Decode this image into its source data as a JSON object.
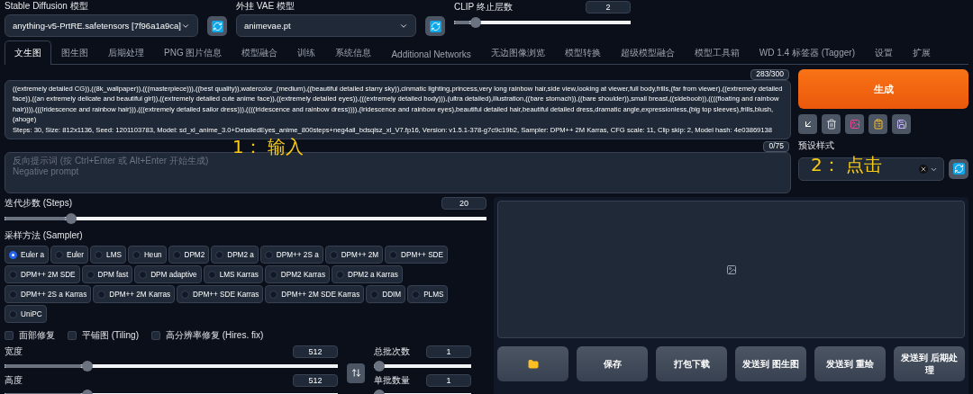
{
  "top_bar": {
    "model": {
      "label": "Stable Diffusion 模型",
      "value": "anything-v5-PrtRE.safetensors [7f96a1a9ca]"
    },
    "vae": {
      "label": "外挂 VAE 模型",
      "value": "animevae.pt"
    },
    "clip": {
      "label": "CLIP 终止层数",
      "value": "2",
      "level": 0.1
    }
  },
  "tabs": [
    {
      "label": "文生图",
      "selected": true
    },
    {
      "label": "图生图",
      "selected": false
    },
    {
      "label": "后期处理",
      "selected": false
    },
    {
      "label": "PNG 图片信息",
      "selected": false
    },
    {
      "label": "模型融合",
      "selected": false
    },
    {
      "label": "训练",
      "selected": false
    },
    {
      "label": "系统信息",
      "selected": false
    },
    {
      "label": "Additional Networks",
      "selected": false
    },
    {
      "label": "无边图像浏览",
      "selected": false
    },
    {
      "label": "模型转换",
      "selected": false
    },
    {
      "label": "超级模型融合",
      "selected": false
    },
    {
      "label": "模型工具箱",
      "selected": false
    },
    {
      "label": "WD 1.4 标签器 (Tagger)",
      "selected": false
    },
    {
      "label": "设置",
      "selected": false
    },
    {
      "label": "扩展",
      "selected": false
    }
  ],
  "prompt": {
    "counter": "283/300",
    "text": "((extremely detailed CG)),((8k_wallpaper)),(((masterpiece))),((best quality)),watercolor_(medium),((beautiful detailed starry sky)),cinmatic lighting,princess,very long rainbow hair,side view,looking at viewer,full body,frills,(far from viewer),((extremely detailed face)),((an extremely delicate and beautiful girl)),((extremely detailed cute anime face)),((extremely detailed eyes)),(((extremely detailed body))),(ultra detailed),illustration,((bare stomach)),((bare shoulder)),small breast,((sideboob)),((((floating and rainbow hair)))),(((Iridescence and rainbow hair))),(((extremely detailed sailor dress))),((((Iridescence and rainbow dress)))),(Iridescence and rainbow eyes),beautiful detailed hair,beautiful detailed dress,dramatic angle,expressionless,(big top sleeves),frills,blush,(ahoge)",
    "params": "Steps: 30, Size: 812x1136, Seed: 1201103783, Model: sd_xl_anime_3.0+DetailedEyes_anime_800steps+neg4all_bdsqlsz_xl_V7.fp16, Version: v1.5.1-378-g7c9c19b2, Sampler: DPM++ 2M Karras, CFG scale: 11, Clip skip: 2, Model hash: 4e03869138"
  },
  "negative_prompt": {
    "counter": "0/75",
    "placeholder": "反向提示词 (按 Ctrl+Enter 或 Alt+Enter 开始生成)\nNegative prompt"
  },
  "generate_button": "生成",
  "styles": {
    "label": "预设样式"
  },
  "annotations": [
    {
      "text": "1： 输入"
    },
    {
      "text": "2： 点击"
    }
  ],
  "steps": {
    "label": "迭代步数 (Steps)",
    "value": "20",
    "level": 0.13
  },
  "sampler": {
    "label": "采样方法 (Sampler)",
    "options": [
      {
        "label": "Euler a",
        "selected": true
      },
      {
        "label": "Euler",
        "selected": false
      },
      {
        "label": "LMS",
        "selected": false
      },
      {
        "label": "Heun",
        "selected": false
      },
      {
        "label": "DPM2",
        "selected": false
      },
      {
        "label": "DPM2 a",
        "selected": false
      },
      {
        "label": "DPM++ 2S a",
        "selected": false
      },
      {
        "label": "DPM++ 2M",
        "selected": false
      },
      {
        "label": "DPM++ SDE",
        "selected": false
      },
      {
        "label": "DPM++ 2M SDE",
        "selected": false
      },
      {
        "label": "DPM fast",
        "selected": false
      },
      {
        "label": "DPM adaptive",
        "selected": false
      },
      {
        "label": "LMS Karras",
        "selected": false
      },
      {
        "label": "DPM2 Karras",
        "selected": false
      },
      {
        "label": "DPM2 a Karras",
        "selected": false
      },
      {
        "label": "DPM++ 2S a Karras",
        "selected": false
      },
      {
        "label": "DPM++ 2M Karras",
        "selected": false
      },
      {
        "label": "DPM++ SDE Karras",
        "selected": false
      },
      {
        "label": "DPM++ 2M SDE Karras",
        "selected": false
      },
      {
        "label": "DDIM",
        "selected": false
      },
      {
        "label": "PLMS",
        "selected": false
      },
      {
        "label": "UniPC",
        "selected": false
      }
    ]
  },
  "checkboxes": [
    {
      "label": "面部修复",
      "checked": false
    },
    {
      "label": "平铺图 (Tiling)",
      "checked": false
    },
    {
      "label": "高分辨率修复 (Hires. fix)",
      "checked": false
    }
  ],
  "size_sliders": [
    {
      "label": "宽度",
      "value": "512",
      "level": 0.24
    },
    {
      "label": "高度",
      "value": "512",
      "level": 0.24
    }
  ],
  "batch_sliders": [
    {
      "label": "总批次数",
      "value": "1",
      "level": 0
    },
    {
      "label": "单批数量",
      "value": "1",
      "level": 0
    }
  ],
  "output_buttons": [
    {
      "kind": "folder"
    },
    {
      "kind": "text",
      "label": "保存"
    },
    {
      "kind": "text",
      "label": "打包下载"
    },
    {
      "kind": "text",
      "label": "发送到 图生图"
    },
    {
      "kind": "text",
      "label": "发送到 重绘"
    },
    {
      "kind": "text",
      "label": "发送到 后期处理"
    }
  ]
}
